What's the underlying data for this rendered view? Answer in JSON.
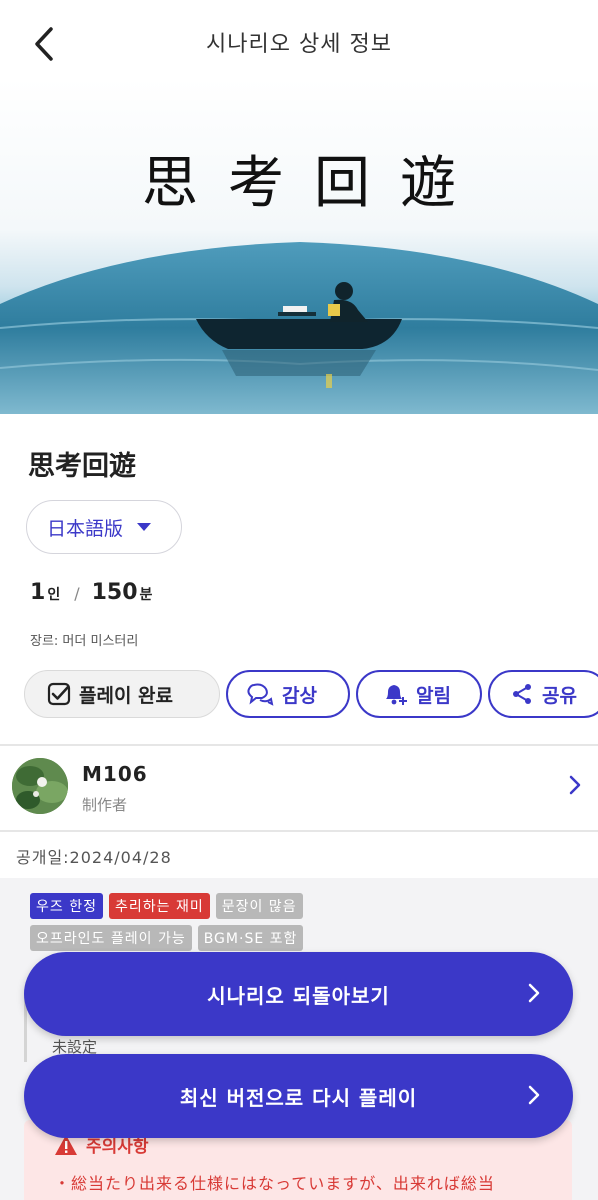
{
  "header": {
    "title": "시나리오 상세 정보",
    "back_icon": "chevron-left-icon"
  },
  "hero": {
    "title_text": "思考回遊"
  },
  "scenario": {
    "title": "思考回遊",
    "version": "日本語版",
    "players_value": "1",
    "players_unit": "인",
    "separator": "/",
    "duration_value": "150",
    "duration_unit": "분",
    "genre": "장르: 머더 미스터리"
  },
  "actions": {
    "play_done": "플레이 완료",
    "watch": "감상",
    "notify": "알림",
    "share": "공유"
  },
  "author": {
    "name": "M106",
    "role": "制作者"
  },
  "release": {
    "text": "공개일:2024/04/28"
  },
  "tags": [
    {
      "label": "우즈 한정",
      "color": "#3b38c8"
    },
    {
      "label": "추리하는 재미",
      "color": "#d83a36"
    },
    {
      "label": "문장이 많음",
      "color": "#b8b8b8"
    },
    {
      "label": "오프라인도 플레이 가능",
      "color": "#b8b8b8"
    },
    {
      "label": "BGM·SE 포함",
      "color": "#b8b8b8"
    }
  ],
  "content": {
    "unset": "未設定"
  },
  "warning": {
    "title": "주의사항",
    "text": "・総当たり出来る仕様にはなっていますが、出来れば総当"
  },
  "buttons": {
    "review": "시나리오 되돌아보기",
    "replay": "최신 버전으로 다시 플레이"
  },
  "colors": {
    "accent": "#3b38c8",
    "danger": "#d83a36",
    "tag_gray": "#b8b8b8"
  }
}
